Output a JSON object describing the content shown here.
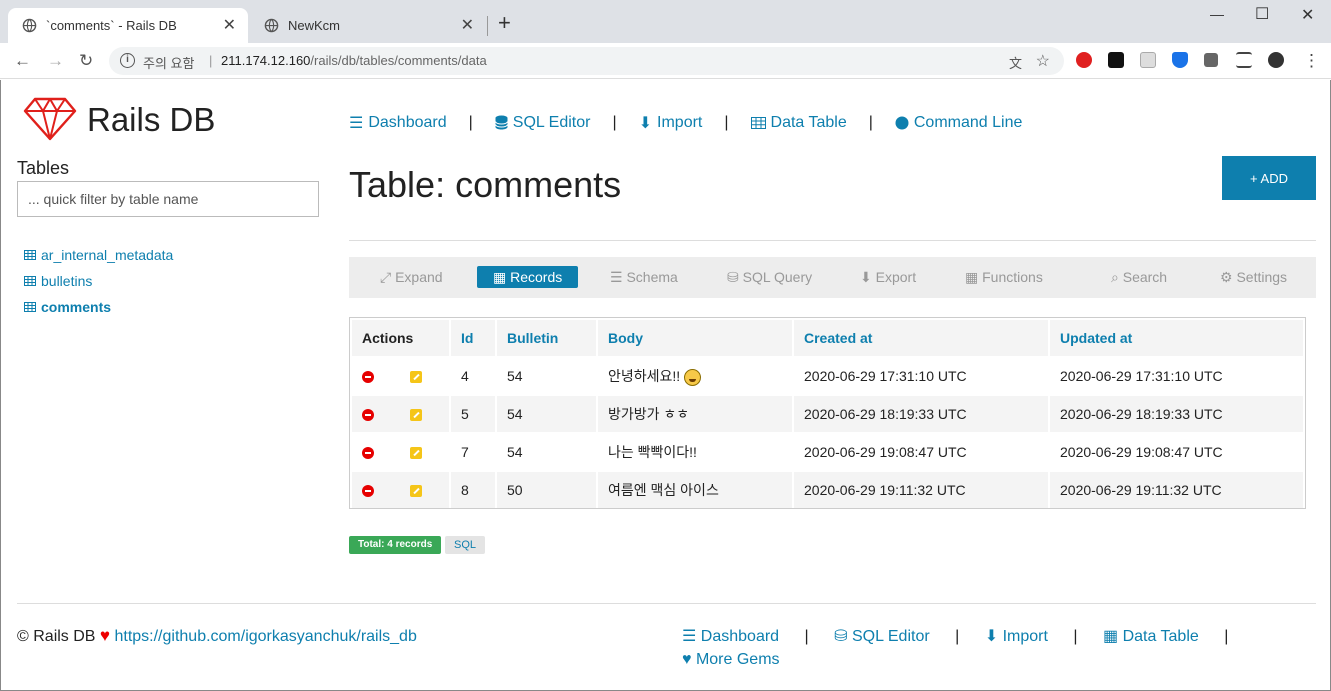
{
  "browser": {
    "tabs": [
      {
        "title": "`comments` - Rails DB"
      },
      {
        "title": "NewKcm"
      }
    ],
    "security_label": "주의 요함",
    "url_host": "211.174.12.160",
    "url_path": "/rails/db/tables/comments/data"
  },
  "app": {
    "brand": "Rails DB",
    "tables_heading": "Tables",
    "filter_placeholder": "... quick filter by table name",
    "tables": [
      {
        "label": "ar_internal_metadata"
      },
      {
        "label": "bulletins"
      },
      {
        "label": "comments"
      }
    ],
    "nav": [
      {
        "label": "Dashboard",
        "icon": "list-icon"
      },
      {
        "label": "SQL Editor",
        "icon": "database-icon"
      },
      {
        "label": "Import",
        "icon": "download-icon"
      },
      {
        "label": "Data Table",
        "icon": "table-icon"
      },
      {
        "label": "Command Line",
        "icon": "circle-icon"
      }
    ],
    "page_title": "Table: comments",
    "add_button": "+ ADD",
    "subnav": [
      {
        "label": "Expand",
        "icon": "expand-icon"
      },
      {
        "label": "Records",
        "icon": "table-icon"
      },
      {
        "label": "Schema",
        "icon": "list-icon"
      },
      {
        "label": "SQL Query",
        "icon": "database-icon"
      },
      {
        "label": "Export",
        "icon": "download-icon"
      },
      {
        "label": "Functions",
        "icon": "grid-icon"
      },
      {
        "label": "Search",
        "icon": "search-icon"
      },
      {
        "label": "Settings",
        "icon": "gears-icon"
      }
    ],
    "table": {
      "headers": [
        "Actions",
        "Id",
        "Bulletin",
        "Body",
        "Created at",
        "Updated at"
      ],
      "rows": [
        {
          "id": "4",
          "bulletin": "54",
          "body": "안녕하세요!!",
          "created": "2020-06-29 17:31:10 UTC",
          "updated": "2020-06-29 17:31:10 UTC"
        },
        {
          "id": "5",
          "bulletin": "54",
          "body": "방가방가 ㅎㅎ",
          "created": "2020-06-29 18:19:33 UTC",
          "updated": "2020-06-29 18:19:33 UTC"
        },
        {
          "id": "7",
          "bulletin": "54",
          "body": "나는 빡빡이다!!",
          "created": "2020-06-29 19:08:47 UTC",
          "updated": "2020-06-29 19:08:47 UTC"
        },
        {
          "id": "8",
          "bulletin": "50",
          "body": "여름엔 맥심 아이스",
          "created": "2020-06-29 19:11:32 UTC",
          "updated": "2020-06-29 19:11:32 UTC"
        }
      ]
    },
    "total_badge": "Total: 4 records",
    "sql_badge": "SQL",
    "footer": {
      "copyright": "© Rails DB",
      "repo_link": "https://github.com/igorkasyanchuk/rails_db",
      "nav": [
        {
          "label": "Dashboard"
        },
        {
          "label": "SQL Editor"
        },
        {
          "label": "Import"
        },
        {
          "label": "Data Table"
        }
      ],
      "more_gems": "More Gems"
    },
    "colors": {
      "accent": "#0e7fae",
      "success": "#3aa857",
      "danger": "#e60000",
      "logo": "#e0201b"
    }
  }
}
